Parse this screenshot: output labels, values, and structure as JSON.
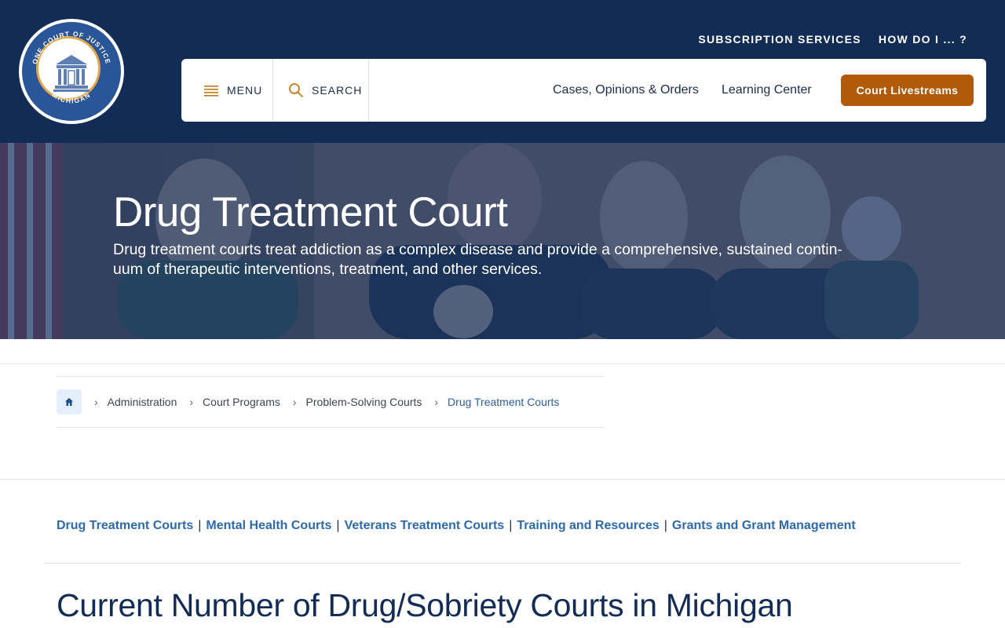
{
  "header": {
    "logo_text_top": "ONE COURT OF JUSTICE",
    "logo_text_bottom": "MICHIGAN",
    "top_links": [
      "SUBSCRIPTION SERVICES",
      "HOW DO I ... ?"
    ],
    "menu_label": "MENU",
    "search_label": "SEARCH",
    "nav_links": [
      "Cases, Opinions & Orders",
      "Learning Center"
    ],
    "cta_label": "Court Livestreams"
  },
  "hero": {
    "title": "Drug Treatment Court",
    "description_line1": "Drug treatment courts treat addiction as a complex disease and provide a comprehensive, sustained contin-",
    "description_line2": "uum of therapeutic interventions, treatment, and other services."
  },
  "breadcrumb": {
    "items": [
      "Administration",
      "Court Programs",
      "Problem-Solving Courts",
      "Drug Treatment Courts"
    ]
  },
  "subnav": {
    "links": [
      "Drug Treatment Courts",
      "Mental Health Courts",
      "Veterans Treatment Courts",
      "Training and Resources",
      "Grants and Grant Management"
    ]
  },
  "main": {
    "heading": "Current Number of Drug/Sobriety Courts in Michigan"
  },
  "colors": {
    "header_bg": "#132c55",
    "cta_bg": "#b35a0a",
    "link": "#2d6aad",
    "accent_icon": "#c47a1c"
  },
  "icons": [
    "court-seal-logo",
    "hamburger-menu-icon",
    "search-icon",
    "home-icon",
    "chevron-right-icon"
  ]
}
